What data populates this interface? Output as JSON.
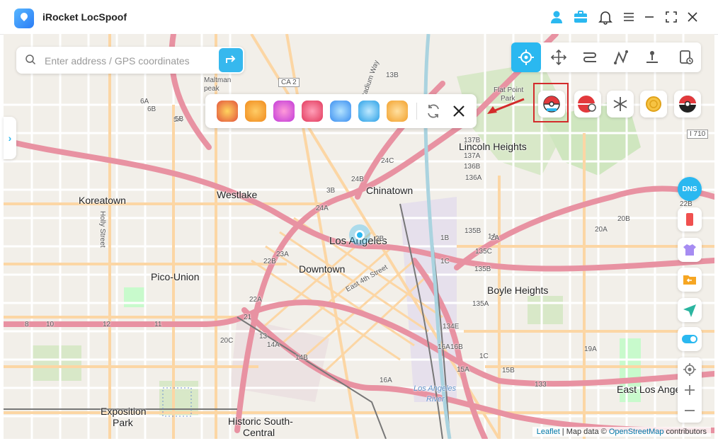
{
  "app": {
    "title": "iRocket LocSpoof"
  },
  "search": {
    "placeholder": "Enter address / GPS coordinates"
  },
  "map": {
    "labels": {
      "chinatown": "Chinatown",
      "westlake": "Westlake",
      "koreatown": "Koreatown",
      "lincoln_heights": "Lincoln Heights",
      "los_angeles": "Los Angeles",
      "downtown": "Downtown",
      "pico_union": "Pico-Union",
      "boyle_heights": "Boyle Heights",
      "exposition_park_1": "Exposition",
      "exposition_park_2": "Park",
      "historic_south_1": "Historic South-",
      "historic_south_2": "Central",
      "east_los_angeles": "East Los Angel",
      "los_angeles_river_1": "Los Angeles",
      "los_angeles_river_2": "River",
      "flat_point_1": "Flat Point",
      "flat_point_2": "Park",
      "maltman_1": "Maltman",
      "maltman_2": "peak",
      "holly_street": "Holly Street",
      "east_4th_street": "East 4th Street",
      "stadium_way": "Stadium Way",
      "ca2": "CA 2",
      "i710": "I 710",
      "hwy_5a": "5A",
      "hwy_5b": "5B",
      "hwy_6a": "6A",
      "hwy_6b": "6B",
      "hwy_13b": "13B",
      "hwy_137b": "137B",
      "hwy_137a": "137A",
      "hwy_136b": "136B",
      "hwy_136a": "136A",
      "hwy_135b": "135B",
      "hwy_135a": "135A",
      "hwy_135c": "135C",
      "hwy_134e": "134E",
      "hwy_22b": "22B",
      "hwy_20a": "20A",
      "hwy_20b": "20B",
      "hwy_20c": "20C",
      "hwy_19a": "19A",
      "hwy_24a": "24A",
      "hwy_24b": "24B",
      "hwy_24c": "24C",
      "hwy_23a": "23A",
      "hwy_23b": "23B",
      "hwy_3b": "3B",
      "hwy_1b": "1B",
      "hwy_1c": "1C",
      "hwy_14b": "14B",
      "hwy_14a": "14A",
      "hwy_16a": "16A",
      "hwy_15a": "15A",
      "hwy_13": "13",
      "hwy_133": "133",
      "hwy_8": "8",
      "hwy_10": "10",
      "hwy_12": "12",
      "hwy_11": "11",
      "hwy_16b": "16B",
      "hwy_2b": "2B",
      "hwy_2a": "2A",
      "hwy_1a": "1A",
      "hwy_15b": "15B",
      "hwy_21": "21",
      "hwy_22a": "22A"
    },
    "attribution": {
      "leaflet": "Leaflet",
      "separator": " | Map data © ",
      "osm": "OpenStreetMap",
      "contributors": " contributors"
    }
  },
  "sidebar": {
    "dns_label": "DNS"
  },
  "left_tab": {
    "arrow": "›"
  },
  "colors": {
    "accent": "#2ab8f0",
    "highlight": "#d32b2b",
    "motorway": "#e892a2",
    "primary": "#fcd6a4",
    "park": "#c8facc"
  }
}
